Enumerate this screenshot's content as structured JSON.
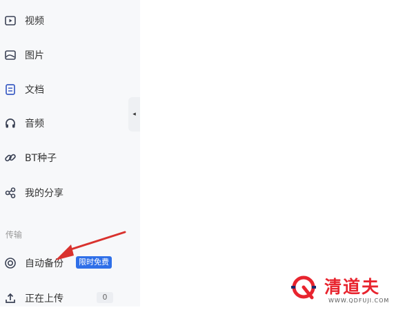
{
  "sidebar": {
    "items": [
      {
        "label": "视频",
        "icon": "video-icon"
      },
      {
        "label": "图片",
        "icon": "image-icon"
      },
      {
        "label": "文档",
        "icon": "document-icon"
      },
      {
        "label": "音频",
        "icon": "headphones-icon"
      },
      {
        "label": "BT种子",
        "icon": "link-icon"
      },
      {
        "label": "我的分享",
        "icon": "share-icon"
      }
    ],
    "section_transfer": "传输",
    "transfer_items": [
      {
        "label": "自动备份",
        "icon": "backup-icon",
        "badge": "限时免费"
      },
      {
        "label": "正在上传",
        "icon": "upload-icon",
        "count": "0"
      }
    ]
  },
  "collapse_glyph": "◂",
  "watermark": {
    "title": "清道夫",
    "url": "WWW.QDFUJI.COM"
  },
  "colors": {
    "accent": "#2f6fe8",
    "annotation_arrow": "#d9322e",
    "watermark": "#e8242e",
    "icon": "#3a4154",
    "document_icon": "#3b5cc4"
  }
}
